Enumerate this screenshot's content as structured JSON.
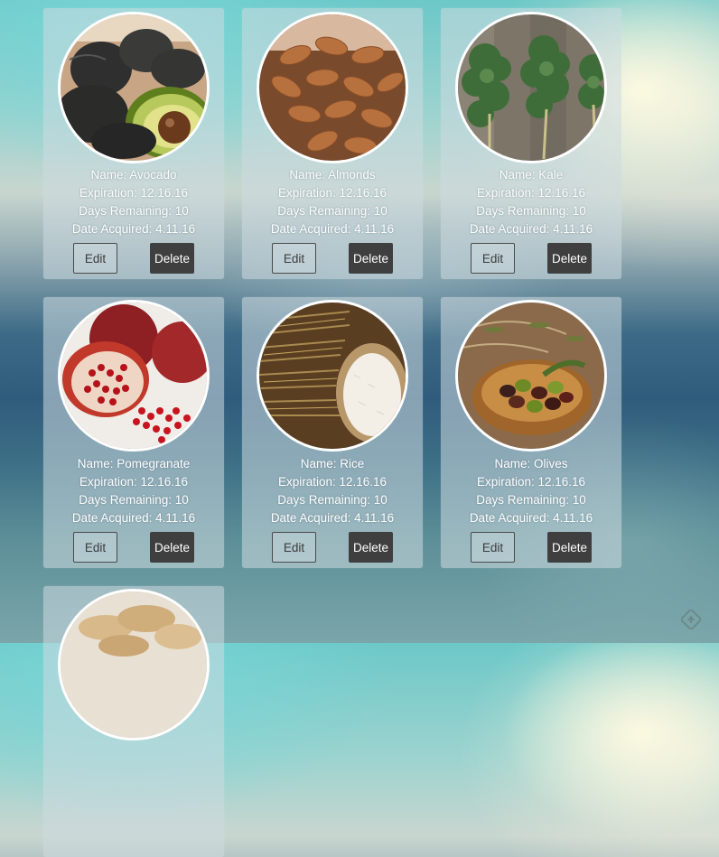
{
  "labels": {
    "name_prefix": "Name: ",
    "expiration_prefix": "Expiration: ",
    "days_prefix": "Days Remaining: ",
    "acquired_prefix": "Date Acquired: ",
    "edit": "Edit",
    "delete": "Delete"
  },
  "items": [
    {
      "name": "Avocado",
      "expiration": "12.16.16",
      "days_remaining": "10",
      "date_acquired": "4.11.16",
      "image": "avocado"
    },
    {
      "name": "Almonds",
      "expiration": "12.16.16",
      "days_remaining": "10",
      "date_acquired": "4.11.16",
      "image": "almonds"
    },
    {
      "name": "Kale",
      "expiration": "12.16.16",
      "days_remaining": "10",
      "date_acquired": "4.11.16",
      "image": "kale"
    },
    {
      "name": "Pomegranate",
      "expiration": "12.16.16",
      "days_remaining": "10",
      "date_acquired": "4.11.16",
      "image": "pomegranate"
    },
    {
      "name": "Rice",
      "expiration": "12.16.16",
      "days_remaining": "10",
      "date_acquired": "4.11.16",
      "image": "rice"
    },
    {
      "name": "Olives",
      "expiration": "12.16.16",
      "days_remaining": "10",
      "date_acquired": "4.11.16",
      "image": "olives"
    },
    {
      "name": "",
      "expiration": "",
      "days_remaining": "",
      "date_acquired": "",
      "image": "ginger"
    }
  ],
  "corner_icon": "feedback-icon"
}
